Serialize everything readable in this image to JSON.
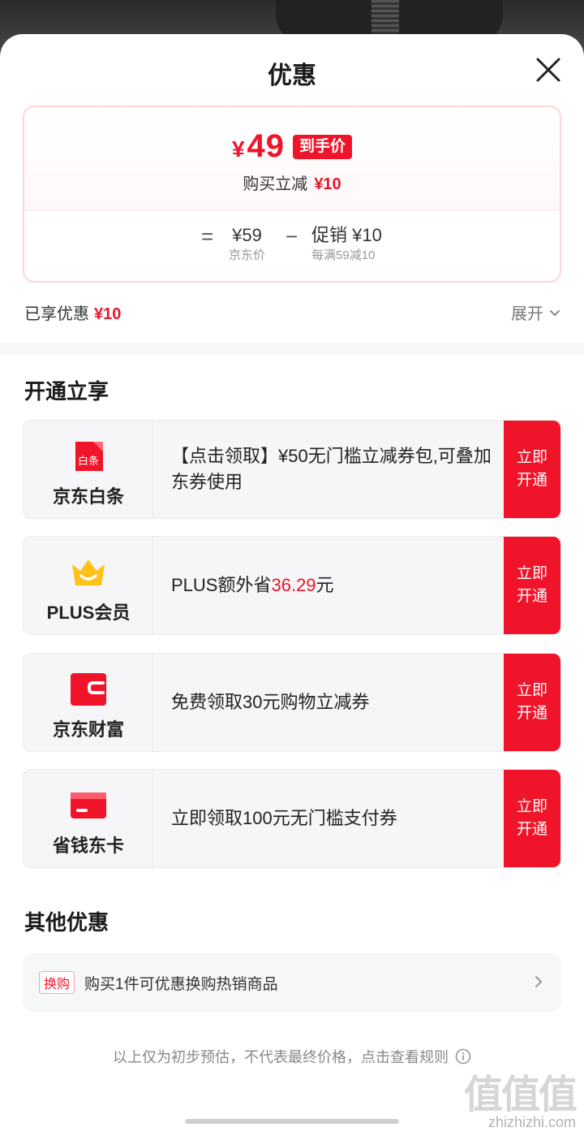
{
  "sheet": {
    "title": "优惠"
  },
  "price": {
    "currency": "¥",
    "final": "49",
    "final_tag": "到手价",
    "instant_label": "购买立减",
    "instant_value": "¥10",
    "equals": "=",
    "base_value": "¥59",
    "base_label": "京东价",
    "minus": "−",
    "promo_value": "促销 ¥10",
    "promo_label": "每满59减10"
  },
  "enjoyed": {
    "label": "已享优惠",
    "value": "¥10",
    "expand_label": "展开"
  },
  "open_section": {
    "title": "开通立享",
    "cards": [
      {
        "name": "京东白条",
        "icon": "baitiao-icon",
        "icon_text": "白条",
        "text": "【点击领取】¥50无门槛立减券包,可叠加东券使用",
        "button": "立即开通"
      },
      {
        "name": "PLUS会员",
        "icon": "crown-icon",
        "text_prefix": "PLUS额外省",
        "text_highlight": "36.29",
        "text_suffix": "元",
        "button": "立即开通"
      },
      {
        "name": "京东财富",
        "icon": "wallet-icon",
        "text": "免费领取30元购物立减券",
        "button": "立即开通"
      },
      {
        "name": "省钱东卡",
        "icon": "card-icon",
        "text": "立即领取100元无门槛支付券",
        "button": "立即开通"
      }
    ]
  },
  "other_section": {
    "title": "其他优惠",
    "tag": "换购",
    "text": "购买1件可优惠换购热销商品"
  },
  "footnote": {
    "text": "以上仅为初步预估，不代表最终价格，点击查看规则"
  },
  "watermark": {
    "mark": "值值值",
    "url": "zhizhizhi.com"
  },
  "colors": {
    "accent": "#f0142a",
    "card_bg": "#f6f6f8",
    "text": "#1a1a1a"
  }
}
